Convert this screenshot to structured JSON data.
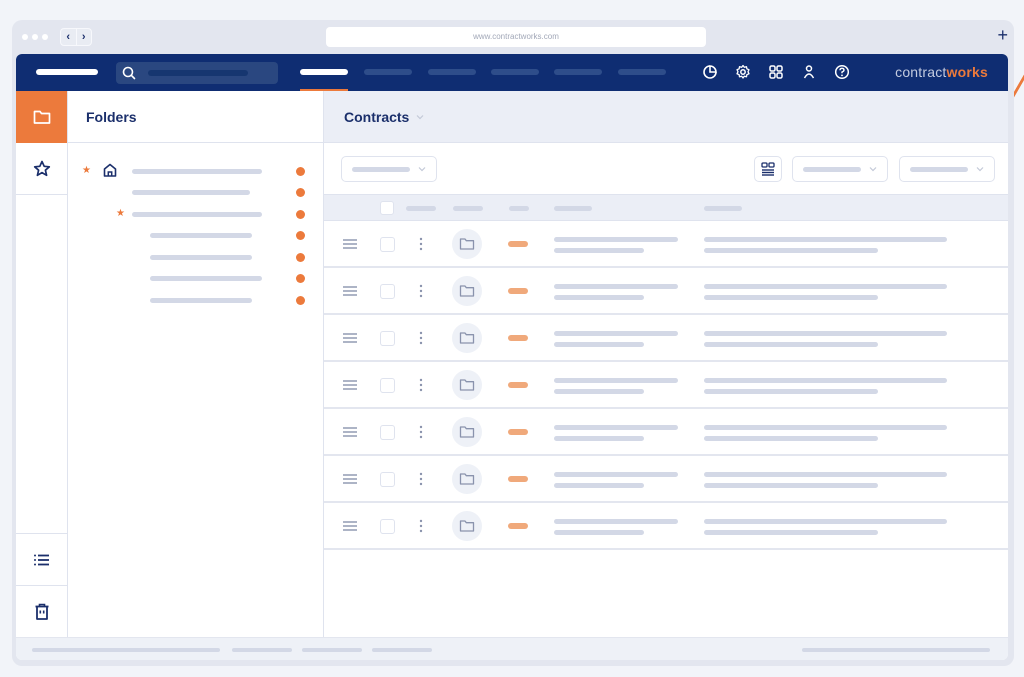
{
  "browser": {
    "url": "www.contractworks.com",
    "back_label": "‹",
    "forward_label": "›",
    "new_tab_label": "+"
  },
  "topbar": {
    "brand_prefix": "contract",
    "brand_suffix": "works",
    "icons": [
      "reports-pie-icon",
      "settings-gear-icon",
      "apps-grid-icon",
      "user-icon",
      "help-icon"
    ],
    "accent_color": "#ec7a3c",
    "nav_color": "#0f2d72"
  },
  "rail": {
    "items": [
      {
        "icon": "folder-icon",
        "active": true
      },
      {
        "icon": "star-icon",
        "active": false
      }
    ],
    "bottom_items": [
      {
        "icon": "list-icon"
      },
      {
        "icon": "trash-icon"
      }
    ]
  },
  "folders": {
    "title": "Folders",
    "tree": [
      {
        "level": 0,
        "starred": true,
        "home": true
      },
      {
        "level": 0,
        "starred": false,
        "home": false
      },
      {
        "level": 0,
        "starred": true,
        "home": false
      },
      {
        "level": 1,
        "starred": false,
        "home": false
      },
      {
        "level": 1,
        "starred": false,
        "home": false
      },
      {
        "level": 1,
        "starred": false,
        "home": false
      },
      {
        "level": 1,
        "starred": false,
        "home": false
      }
    ]
  },
  "main": {
    "title": "Contracts",
    "row_count": 7
  }
}
